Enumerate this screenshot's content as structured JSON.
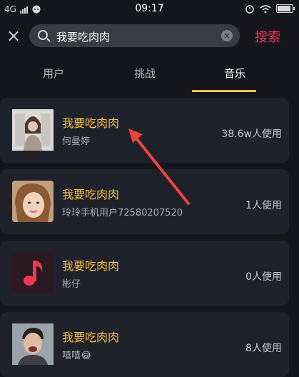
{
  "status": {
    "network": "4G",
    "time": "09:17"
  },
  "search": {
    "close_icon": "×",
    "query": "我要吃肉肉",
    "clear_icon": "×",
    "button_label": "搜索"
  },
  "tabs": [
    {
      "label": "用户"
    },
    {
      "label": "挑战"
    },
    {
      "label": "音乐"
    }
  ],
  "active_tab": "音乐",
  "results": [
    {
      "title": "我要吃肉肉",
      "artist": "何曼婷",
      "uses": "38.6w人使用"
    },
    {
      "title": "我要吃肉肉",
      "artist": "玲玲手机用户72580207520",
      "uses": "1人使用"
    },
    {
      "title": "我要吃肉肉",
      "artist": "彬仔",
      "uses": "0人使用"
    },
    {
      "title": "我要吃肉肉",
      "artist": "嘻嘻😂",
      "uses": "8人使用"
    }
  ],
  "colors": {
    "accent": "#f03a5f",
    "title": "#f5c242",
    "annotation_arrow": "#e8453c"
  }
}
